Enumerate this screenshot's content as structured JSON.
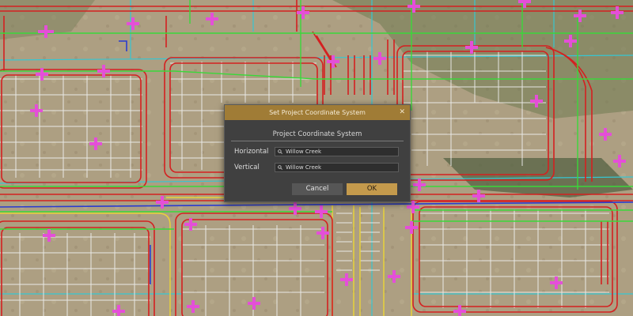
{
  "dialog": {
    "title": "Set Project Coordinate System",
    "close_glyph": "✕",
    "section_heading": "Project Coordinate System",
    "horizontal": {
      "label": "Horizontal",
      "value": "Willow Creek",
      "icon": "search-icon"
    },
    "vertical": {
      "label": "Vertical",
      "value": "Willow Creek",
      "icon": "search-icon"
    },
    "cancel_label": "Cancel",
    "ok_label": "OK"
  },
  "colors": {
    "accent": "#c49a4c",
    "title_bar": "#a07c36",
    "dialog_bg": "#404040",
    "cad_red": "#d42020",
    "cad_green": "#3ad83a",
    "cad_cyan": "#36c6d2",
    "cad_magenta": "#e44fd8",
    "cad_yellow": "#e8d23a",
    "cad_blue": "#2a3cd0",
    "grid_white": "#f0f0f0"
  }
}
